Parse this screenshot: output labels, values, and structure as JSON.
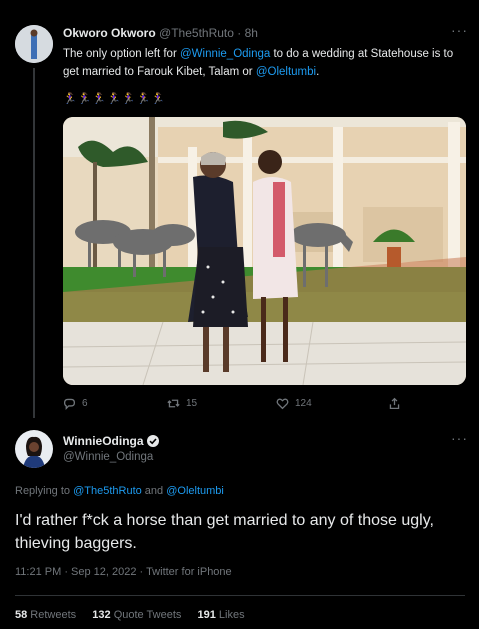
{
  "tweet1": {
    "display_name": "Okworo Okworo",
    "handle": "@The5thRuto",
    "time": "· 8h",
    "text_pre": "The only option left for ",
    "mention1": "@Winnie_Odinga",
    "text_mid": " to do a wedding at Statehouse is to get married to Farouk Kibet, Talam or ",
    "mention2": "@Oleltumbi",
    "text_post": ".",
    "emoji_row": "🏃‍♀️🏃‍♀️🏃‍♀️🏃‍♀️🏃‍♀️🏃‍♀️🏃‍♀️",
    "replies": "6",
    "retweets": "15",
    "likes": "124"
  },
  "tweet2": {
    "display_name": "WinnieOdinga",
    "handle": "@Winnie_Odinga",
    "replying_to_label": "Replying to ",
    "replying_user1": "@The5thRuto",
    "replying_and": " and ",
    "replying_user2": "@Oleltumbi",
    "text": "I'd rather f*ck a horse than get married to any of those ugly, thieving baggers.",
    "timestamp": "11:21 PM · Sep 12, 2022 · Twitter for iPhone",
    "retweets_count": "58",
    "retweets_label": " Retweets",
    "quotes_count": "132",
    "quotes_label": " Quote Tweets",
    "likes_count": "191",
    "likes_label": " Likes"
  },
  "icons": {
    "more": "more-icon",
    "verified": "verified-badge-icon",
    "reply": "reply-icon",
    "retweet": "retweet-icon",
    "like": "like-icon",
    "share": "share-icon"
  },
  "colors": {
    "background": "#000000",
    "text": "#e7e9ea",
    "muted": "#71767b",
    "link": "#1d9bf0",
    "divider": "#2f3336"
  }
}
